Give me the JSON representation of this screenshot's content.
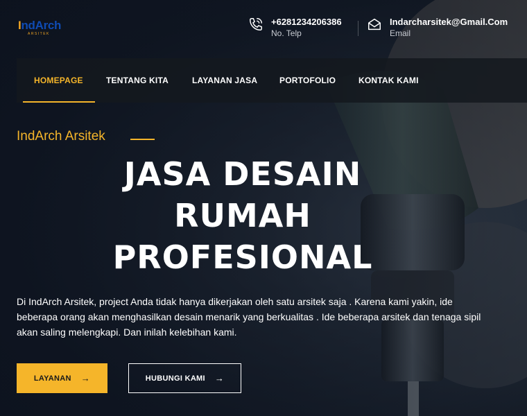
{
  "brand": {
    "logo_text": "IndArch",
    "logo_sub": "ARSITEK"
  },
  "contact": {
    "phone": {
      "value": "+6281234206386",
      "label": "No. Telp",
      "icon": "phone-icon"
    },
    "email": {
      "value": "Indarcharsitek@Gmail.Com",
      "label": "Email",
      "icon": "mail-icon"
    }
  },
  "nav": {
    "items": [
      {
        "label": "HOMEPAGE",
        "active": true
      },
      {
        "label": "TENTANG KITA",
        "active": false
      },
      {
        "label": "LAYANAN JASA",
        "active": false
      },
      {
        "label": "PORTOFOLIO",
        "active": false
      },
      {
        "label": "KONTAK KAMI",
        "active": false
      }
    ]
  },
  "hero": {
    "tagline": "IndArch Arsitek",
    "headline_lines": [
      "JASA DESAIN",
      "RUMAH",
      "PROFESIONAL"
    ],
    "description": "Di IndArch Arsitek, project Anda tidak hanya dikerjakan oleh satu arsitek saja . Karena kami yakin, ide beberapa orang akan menghasilkan desain menarik yang berkualitas . Ide beberapa arsitek dan tenaga sipil akan saling melengkapi. Dan inilah kelebihan kami.",
    "buttons": {
      "primary": {
        "label": "LAYANAN",
        "icon": "arrow-right-icon"
      },
      "secondary": {
        "label": "HUBUNGI KAMI",
        "icon": "arrow-right-icon"
      }
    }
  },
  "colors": {
    "accent": "#f5b52a",
    "brand_blue": "#0f4bb3",
    "background": "#141b26"
  }
}
